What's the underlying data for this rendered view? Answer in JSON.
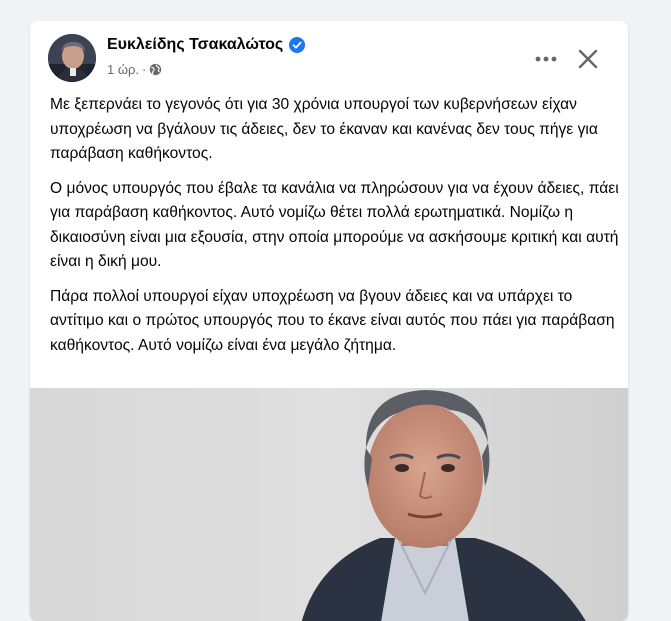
{
  "post": {
    "author_name": "Ευκλείδης Τσακαλώτος",
    "time": "1 ώρ.",
    "separator": "·",
    "paragraphs": [
      "Με ξεπερνάει το γεγονός ότι για 30 χρόνια υπουργοί των κυβερνήσεων είχαν υποχρέωση να βγάλουν τις άδειες, δεν το έκαναν και κανένας δεν τους πήγε για παράβαση καθήκοντος.",
      "Ο μόνος υπουργός που έβαλε τα κανάλια να πληρώσουν για να έχουν άδειες, πάει για παράβαση καθήκοντος. Αυτό νομίζω θέτει πολλά ερωτηματικά. Νομίζω η δικαιοσύνη είναι μια εξουσία, στην οποία μπορούμε να ασκήσουμε κριτική και αυτή είναι η δική μου.",
      "Πάρα πολλοί υπουργοί είχαν υποχρέωση να βγουν άδειες και να υπάρχει το αντίτιμο και ο πρώτος υπουργός που το έκανε είναι αυτός που πάει για παράβαση καθήκοντος. Αυτό νομίζω είναι ένα μεγάλο ζήτημα."
    ]
  },
  "icons": {
    "verified": "verified-badge-icon",
    "audience": "globe-icon",
    "more": "more-options-icon",
    "close": "close-icon"
  },
  "colors": {
    "page_background": "#f0f2f5",
    "card_background": "#ffffff",
    "text_primary": "#050505",
    "text_secondary": "#65676b",
    "verified_blue": "#1877f2"
  }
}
